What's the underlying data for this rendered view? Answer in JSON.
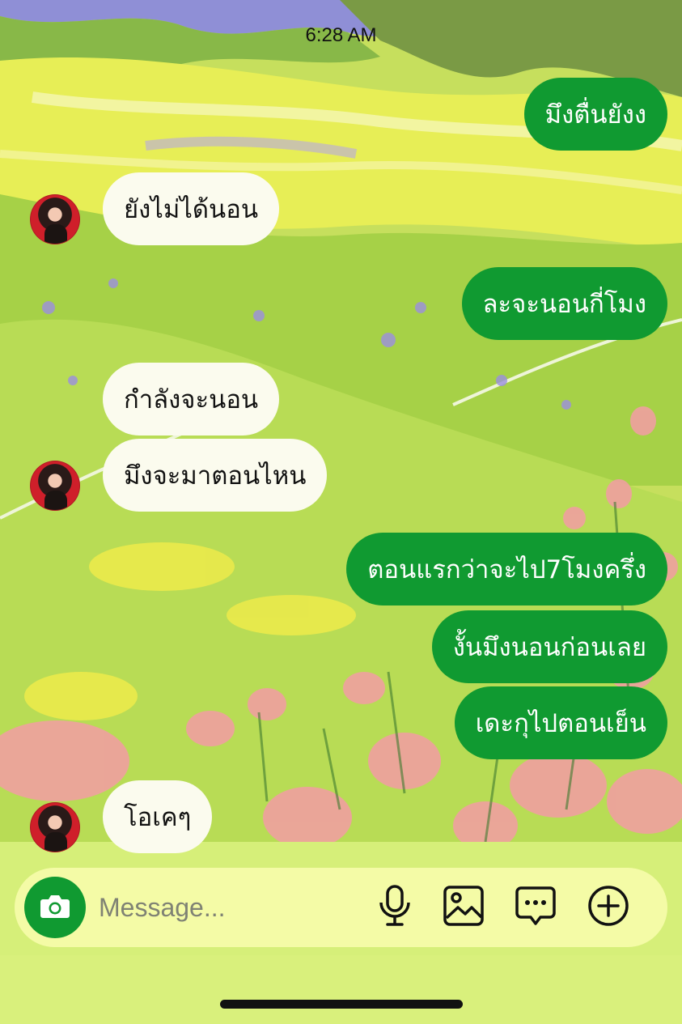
{
  "status_bar": {
    "time": "6:28 AM"
  },
  "messages": [
    {
      "sender": "me",
      "text": "มึงตื่นยังง"
    },
    {
      "sender": "friend",
      "text": "ยังไม่ได้นอน"
    },
    {
      "sender": "me",
      "text": "ละจะนอนกี่โมง"
    },
    {
      "sender": "friend",
      "text": "กำลังจะนอน"
    },
    {
      "sender": "friend",
      "text": "มึงจะมาตอนไหน"
    },
    {
      "sender": "me",
      "text": "ตอนแรกว่าจะไป7โมงครึ่ง"
    },
    {
      "sender": "me",
      "text": "งั้นมึงนอนก่อนเลย"
    },
    {
      "sender": "me",
      "text": "เดะกุไปตอนเย็น"
    },
    {
      "sender": "friend",
      "text": "โอเคๆ"
    }
  ],
  "composer": {
    "placeholder": "Message...",
    "icons": [
      "camera-icon",
      "microphone-icon",
      "image-icon",
      "sticker-icon",
      "plus-icon"
    ]
  },
  "colors": {
    "outgoing_bubble": "#109a31",
    "incoming_bubble": "#fbfbee",
    "composer_bg": "#f4fba6",
    "accent": "#109a31"
  }
}
